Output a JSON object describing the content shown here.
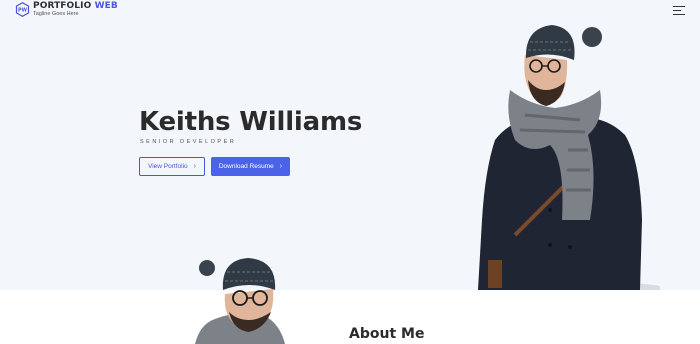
{
  "header": {
    "brand_title_part1": "PORTFOLIO",
    "brand_title_part2": "WEB",
    "logo_text": "PW",
    "tagline": "Tagline Goes Here",
    "logo_icon": "hexagon-logo-icon",
    "menu_icon": "hamburger-menu-icon"
  },
  "hero": {
    "name": "Keiths Williams",
    "role": "SENIOR DEVELOPER",
    "buttons": {
      "view_portfolio": "View Portfolio",
      "download_resume": "Download Resume",
      "chevron": "›"
    }
  },
  "about": {
    "title": "About Me"
  },
  "colors": {
    "accent": "#4b63e9",
    "hero_bg": "#f3f6fa",
    "text": "#2b2b2b"
  }
}
